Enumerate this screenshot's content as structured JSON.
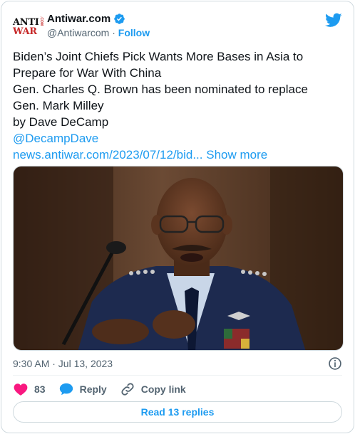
{
  "author": {
    "logo_line1": "ANTI",
    "logo_line2": "WAR",
    "logo_side": ".COM",
    "display_name": "Antiwar.com",
    "handle": "@Antiwarcom",
    "separator": "·",
    "follow_label": "Follow"
  },
  "tweet": {
    "lines": [
      "Biden’s Joint Chiefs Pick Wants More Bases in Asia to",
      "Prepare for War With China",
      "Gen. Charles Q. Brown has been nominated to replace",
      "Gen. Mark Milley",
      "by Dave DeCamp"
    ],
    "mention": "@DecampDave",
    "url": "news.antiwar.com/2023/07/12/bid...",
    "show_more": "Show more"
  },
  "meta": {
    "timestamp": "9:30 AM · Jul 13, 2023"
  },
  "actions": {
    "like_count": "83",
    "reply_label": "Reply",
    "copy_label": "Copy link"
  },
  "read_replies_label": "Read 13 replies",
  "colors": {
    "accent": "#1d9bf0",
    "like": "#f91880",
    "muted": "#536471"
  },
  "icons": [
    "twitter-bird-icon",
    "verified-badge-icon",
    "info-icon",
    "heart-icon",
    "reply-bubble-icon",
    "link-icon"
  ]
}
